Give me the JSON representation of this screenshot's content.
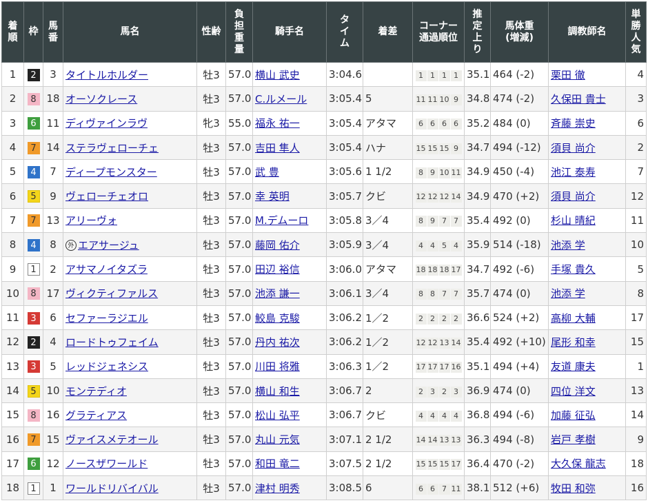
{
  "headers": [
    "着\n順",
    "枠",
    "馬\n番",
    "馬名",
    "性齢",
    "負\n担\n重\n量",
    "騎手名",
    "タ\nイ\nム",
    "着差",
    "コーナー\n通過順位",
    "推\n定\n上\nり",
    "馬体重\n(増減)",
    "調教師名",
    "単\n勝\n人\n気"
  ],
  "waku_colors": {
    "1": {
      "bg": "#ffffff",
      "fg": "#333333",
      "border": "#888888"
    },
    "2": {
      "bg": "#222222",
      "fg": "#ffffff",
      "border": "#222222"
    },
    "3": {
      "bg": "#d53a35",
      "fg": "#ffffff",
      "border": "#d53a35"
    },
    "4": {
      "bg": "#2f73c9",
      "fg": "#ffffff",
      "border": "#2f73c9"
    },
    "5": {
      "bg": "#f3d51a",
      "fg": "#333333",
      "border": "#e0c310"
    },
    "6": {
      "bg": "#3f9f3f",
      "fg": "#ffffff",
      "border": "#3f9f3f"
    },
    "7": {
      "bg": "#f09a2a",
      "fg": "#333333",
      "border": "#f09a2a"
    },
    "8": {
      "bg": "#f4b6c5",
      "fg": "#333333",
      "border": "#f4b6c5"
    }
  },
  "rows": [
    {
      "rank": "1",
      "waku": "2",
      "umaban": "3",
      "horse": "タイトルホルダー",
      "foreign": false,
      "sex_age": "牡3",
      "weight": "57.0",
      "jockey": "横山 武史",
      "time": "3:04.6",
      "margin": "",
      "passing": [
        "1",
        "1",
        "1",
        "1"
      ],
      "last3f": "35.1",
      "body_weight": "464 (-2)",
      "trainer": "栗田 徹",
      "popularity": "4"
    },
    {
      "rank": "2",
      "waku": "8",
      "umaban": "18",
      "horse": "オーソクレース",
      "foreign": false,
      "sex_age": "牡3",
      "weight": "57.0",
      "jockey": "C.ルメール",
      "time": "3:05.4",
      "margin": "5",
      "passing": [
        "11",
        "11",
        "10",
        "9"
      ],
      "last3f": "34.8",
      "body_weight": "474 (-2)",
      "trainer": "久保田 貴士",
      "popularity": "3"
    },
    {
      "rank": "3",
      "waku": "6",
      "umaban": "11",
      "horse": "ディヴァインラヴ",
      "foreign": false,
      "sex_age": "牝3",
      "weight": "55.0",
      "jockey": "福永 祐一",
      "time": "3:05.4",
      "margin": "アタマ",
      "passing": [
        "6",
        "6",
        "6",
        "6"
      ],
      "last3f": "35.2",
      "body_weight": "484 (0)",
      "trainer": "斉藤 崇史",
      "popularity": "6"
    },
    {
      "rank": "4",
      "waku": "7",
      "umaban": "14",
      "horse": "ステラヴェローチェ",
      "foreign": false,
      "sex_age": "牡3",
      "weight": "57.0",
      "jockey": "吉田 隼人",
      "time": "3:05.4",
      "margin": "ハナ",
      "passing": [
        "15",
        "15",
        "15",
        "9"
      ],
      "last3f": "34.7",
      "body_weight": "494 (-12)",
      "trainer": "須貝 尚介",
      "popularity": "2"
    },
    {
      "rank": "5",
      "waku": "4",
      "umaban": "7",
      "horse": "ディープモンスター",
      "foreign": false,
      "sex_age": "牡3",
      "weight": "57.0",
      "jockey": "武 豊",
      "time": "3:05.6",
      "margin": "1 1/2",
      "passing": [
        "8",
        "9",
        "10",
        "11"
      ],
      "last3f": "34.9",
      "body_weight": "450 (-4)",
      "trainer": "池江 泰寿",
      "popularity": "7"
    },
    {
      "rank": "6",
      "waku": "5",
      "umaban": "9",
      "horse": "ヴェローチェオロ",
      "foreign": false,
      "sex_age": "牡3",
      "weight": "57.0",
      "jockey": "幸 英明",
      "time": "3:05.7",
      "margin": "クビ",
      "passing": [
        "12",
        "12",
        "12",
        "14"
      ],
      "last3f": "34.9",
      "body_weight": "470 (+2)",
      "trainer": "須貝 尚介",
      "popularity": "12"
    },
    {
      "rank": "7",
      "waku": "7",
      "umaban": "13",
      "horse": "アリーヴォ",
      "foreign": false,
      "sex_age": "牡3",
      "weight": "57.0",
      "jockey": "M.デムーロ",
      "time": "3:05.8",
      "margin": "3／4",
      "passing": [
        "8",
        "9",
        "7",
        "7"
      ],
      "last3f": "35.4",
      "body_weight": "492 (0)",
      "trainer": "杉山 晴紀",
      "popularity": "11"
    },
    {
      "rank": "8",
      "waku": "4",
      "umaban": "8",
      "horse": "エアサージュ",
      "foreign": true,
      "sex_age": "牡3",
      "weight": "57.0",
      "jockey": "藤岡 佑介",
      "time": "3:05.9",
      "margin": "3／4",
      "passing": [
        "4",
        "4",
        "5",
        "4"
      ],
      "last3f": "35.9",
      "body_weight": "514 (-18)",
      "trainer": "池添 学",
      "popularity": "10"
    },
    {
      "rank": "9",
      "waku": "1",
      "umaban": "2",
      "horse": "アサマノイタズラ",
      "foreign": false,
      "sex_age": "牡3",
      "weight": "57.0",
      "jockey": "田辺 裕信",
      "time": "3:06.0",
      "margin": "アタマ",
      "passing": [
        "18",
        "18",
        "18",
        "17"
      ],
      "last3f": "34.7",
      "body_weight": "492 (-6)",
      "trainer": "手塚 貴久",
      "popularity": "5"
    },
    {
      "rank": "10",
      "waku": "8",
      "umaban": "17",
      "horse": "ヴィクティファルス",
      "foreign": false,
      "sex_age": "牡3",
      "weight": "57.0",
      "jockey": "池添 謙一",
      "time": "3:06.1",
      "margin": "3／4",
      "passing": [
        "8",
        "8",
        "7",
        "7"
      ],
      "last3f": "35.7",
      "body_weight": "474 (0)",
      "trainer": "池添 学",
      "popularity": "8"
    },
    {
      "rank": "11",
      "waku": "3",
      "umaban": "6",
      "horse": "セファーラジエル",
      "foreign": false,
      "sex_age": "牡3",
      "weight": "57.0",
      "jockey": "鮫島 克駿",
      "time": "3:06.2",
      "margin": "1／2",
      "passing": [
        "2",
        "2",
        "2",
        "2"
      ],
      "last3f": "36.6",
      "body_weight": "524 (+2)",
      "trainer": "高柳 大輔",
      "popularity": "17"
    },
    {
      "rank": "12",
      "waku": "2",
      "umaban": "4",
      "horse": "ロードトゥフェイム",
      "foreign": false,
      "sex_age": "牡3",
      "weight": "57.0",
      "jockey": "丹内 祐次",
      "time": "3:06.2",
      "margin": "1／2",
      "passing": [
        "12",
        "12",
        "13",
        "14"
      ],
      "last3f": "35.4",
      "body_weight": "492 (+10)",
      "trainer": "尾形 和幸",
      "popularity": "15"
    },
    {
      "rank": "13",
      "waku": "3",
      "umaban": "5",
      "horse": "レッドジェネシス",
      "foreign": false,
      "sex_age": "牡3",
      "weight": "57.0",
      "jockey": "川田 将雅",
      "time": "3:06.3",
      "margin": "1／2",
      "passing": [
        "17",
        "17",
        "17",
        "16"
      ],
      "last3f": "35.1",
      "body_weight": "494 (+4)",
      "trainer": "友道 康夫",
      "popularity": "1"
    },
    {
      "rank": "14",
      "waku": "5",
      "umaban": "10",
      "horse": "モンテディオ",
      "foreign": false,
      "sex_age": "牡3",
      "weight": "57.0",
      "jockey": "横山 和生",
      "time": "3:06.7",
      "margin": "2",
      "passing": [
        "2",
        "3",
        "2",
        "3"
      ],
      "last3f": "36.9",
      "body_weight": "474 (0)",
      "trainer": "四位 洋文",
      "popularity": "13"
    },
    {
      "rank": "15",
      "waku": "8",
      "umaban": "16",
      "horse": "グラティアス",
      "foreign": false,
      "sex_age": "牡3",
      "weight": "57.0",
      "jockey": "松山 弘平",
      "time": "3:06.7",
      "margin": "クビ",
      "passing": [
        "4",
        "4",
        "4",
        "4"
      ],
      "last3f": "36.8",
      "body_weight": "494 (-6)",
      "trainer": "加藤 征弘",
      "popularity": "14"
    },
    {
      "rank": "16",
      "waku": "7",
      "umaban": "15",
      "horse": "ヴァイスメテオール",
      "foreign": false,
      "sex_age": "牡3",
      "weight": "57.0",
      "jockey": "丸山 元気",
      "time": "3:07.1",
      "margin": "2 1/2",
      "passing": [
        "14",
        "14",
        "13",
        "13"
      ],
      "last3f": "36.3",
      "body_weight": "494 (-8)",
      "trainer": "岩戸 孝樹",
      "popularity": "9"
    },
    {
      "rank": "17",
      "waku": "6",
      "umaban": "12",
      "horse": "ノースザワールド",
      "foreign": false,
      "sex_age": "牡3",
      "weight": "57.0",
      "jockey": "和田 竜二",
      "time": "3:07.5",
      "margin": "2 1/2",
      "passing": [
        "15",
        "15",
        "15",
        "17"
      ],
      "last3f": "36.4",
      "body_weight": "470 (-2)",
      "trainer": "大久保 龍志",
      "popularity": "18"
    },
    {
      "rank": "18",
      "waku": "1",
      "umaban": "1",
      "horse": "ワールドリバイバル",
      "foreign": false,
      "sex_age": "牡3",
      "weight": "57.0",
      "jockey": "津村 明秀",
      "time": "3:08.5",
      "margin": "6",
      "passing": [
        "6",
        "6",
        "7",
        "11"
      ],
      "last3f": "38.1",
      "body_weight": "512 (+6)",
      "trainer": "牧田 和弥",
      "popularity": "16"
    }
  ],
  "foreign_mark": "外"
}
